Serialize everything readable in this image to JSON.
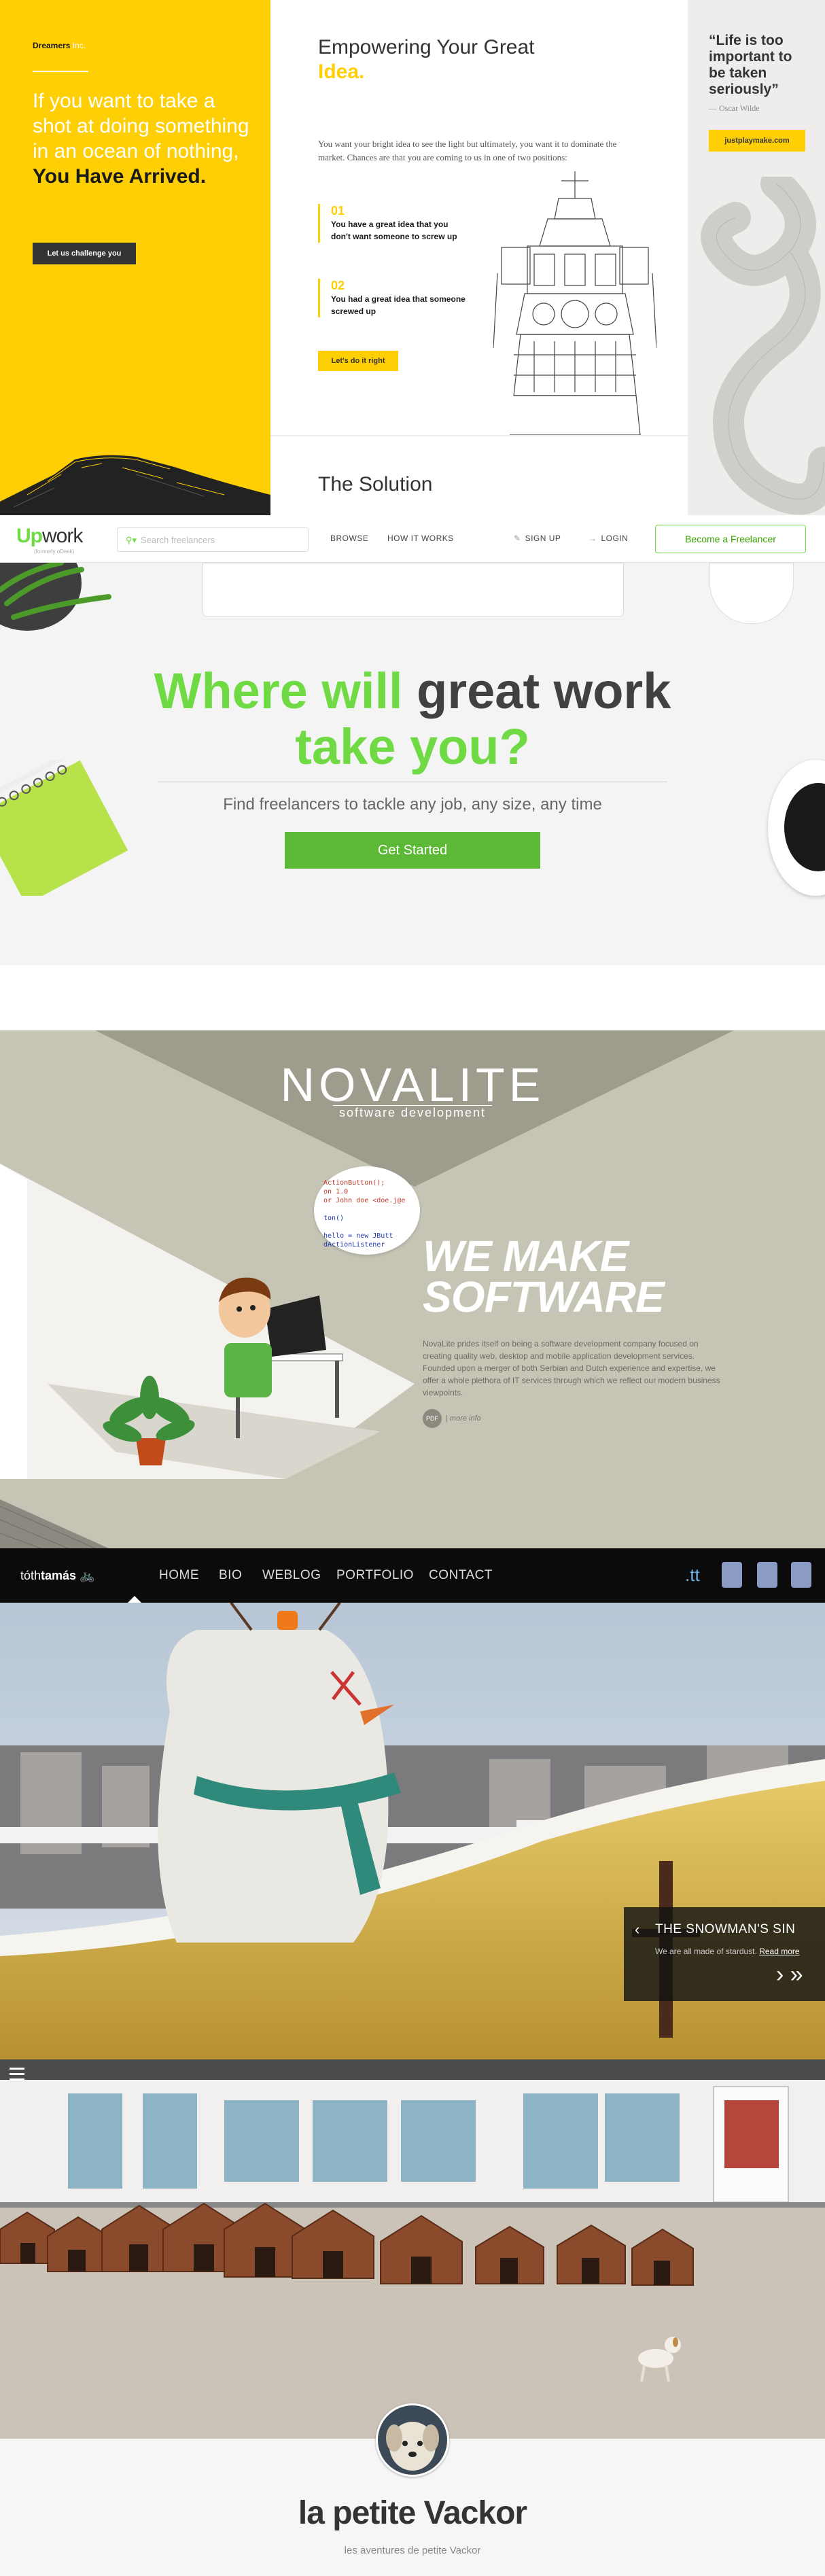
{
  "dreamers": {
    "brand": "Dreamers",
    "brand_suffix": "Inc.",
    "hero_line": "If you want to take a shot at doing something in an ocean of nothing,",
    "hero_bold": "You Have Arrived.",
    "cta": "Let us challenge you",
    "heading": "Empowering Your Great",
    "heading_accent": "Idea.",
    "intro": "You want your bright idea to see the light but ultimately, you want it to dominate the market. Chances are that you are coming to us in one of two positions:",
    "points": [
      {
        "num": "01",
        "text": "You have a great idea that you don't want someone to screw up"
      },
      {
        "num": "02",
        "text": "You had a great idea that someone screwed up"
      }
    ],
    "do_it": "Let's do it right",
    "solution": "The Solution",
    "quote": "“Life is too important to be taken seriously”",
    "quote_author": "— Oscar Wilde",
    "quote_link": "justplaymake.com",
    "colors": {
      "accent": "#ffcf06",
      "dark": "#333333"
    }
  },
  "upwork": {
    "logo": "Up",
    "logo_rest": "work",
    "tagline": "(formerly oDesk)",
    "search_placeholder": "Search freelancers",
    "nav": [
      "BROWSE",
      "HOW IT WORKS"
    ],
    "signup": "SIGN UP",
    "login": "LOGIN",
    "become": "Become a Freelancer",
    "headline_a": "Where will",
    "headline_b": "great work",
    "headline_c": "take you?",
    "subhead": "Find freelancers to tackle any job, any size, any time",
    "cta": "Get Started",
    "colors": {
      "green": "#6fda44",
      "button": "#5cb936"
    }
  },
  "novalite": {
    "logo": "NOVALITE",
    "tagline": "software development",
    "code_lines": [
      "ActionButton();",
      "on 1.0",
      "or John doe <doe.j@e",
      "",
      "ton()",
      "",
      "hello = new JButt",
      "dActionListener"
    ],
    "headline_1": "WE MAKE",
    "headline_2": "SOFTWARE",
    "description": "NovaLite prides itself on being a software development company focused on creating quality web, desktop and mobile application development services. Founded upon a merger of both Serbian and Dutch experience and expertise, we offer a whole plethora of IT services through which we reflect our modern business viewpoints.",
    "pdf": "PDF",
    "more_info": "more info"
  },
  "tothtamas": {
    "logo_a": "tóth",
    "logo_b": "tamás",
    "nav": [
      "HOME",
      "BIO",
      "WEBLOG",
      "PORTFOLIO",
      "CONTACT"
    ],
    "tt": ".tt",
    "caption_title": "THE SNOWMAN'S SIN",
    "caption_text": "We are all made of stardust.",
    "caption_link": "Read more",
    "prev": "‹",
    "next": "› »"
  },
  "vackor": {
    "title": "la petite Vackor",
    "subtitle": "les aventures de petite Vackor"
  }
}
